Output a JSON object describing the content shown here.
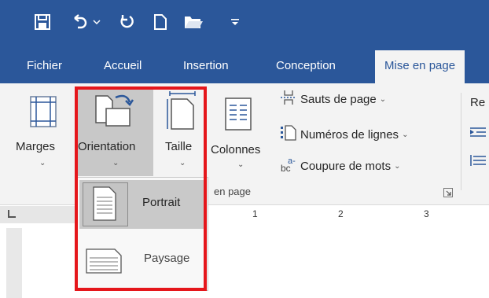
{
  "colors": {
    "accent": "#2b579a",
    "ribbon_bg": "#f3f3f3",
    "highlight": "#e5161b"
  },
  "qat": {
    "icons": [
      "save-icon",
      "undo-icon",
      "dropdown-arrow-icon",
      "redo-icon",
      "new-document-icon",
      "open-folder-icon",
      "customize-qat-icon"
    ]
  },
  "tabs": [
    {
      "label": "Fichier"
    },
    {
      "label": "Accueil"
    },
    {
      "label": "Insertion"
    },
    {
      "label": "Conception"
    },
    {
      "label": "Mise en page",
      "active": true
    }
  ],
  "ribbon": {
    "marges": "Marges",
    "orientation": "Orientation",
    "taille": "Taille",
    "colonnes": "Colonnes",
    "sauts": "Sauts de page",
    "numeros": "Numéros de lignes",
    "coupure": "Coupure de mots",
    "group_label": "en page",
    "partial_right": "Re"
  },
  "ruler": {
    "marks": [
      "1",
      "2",
      "3"
    ]
  },
  "orientation_menu": {
    "items": [
      {
        "label": "Portrait",
        "selected": true
      },
      {
        "label": "Paysage",
        "selected": false
      }
    ]
  }
}
